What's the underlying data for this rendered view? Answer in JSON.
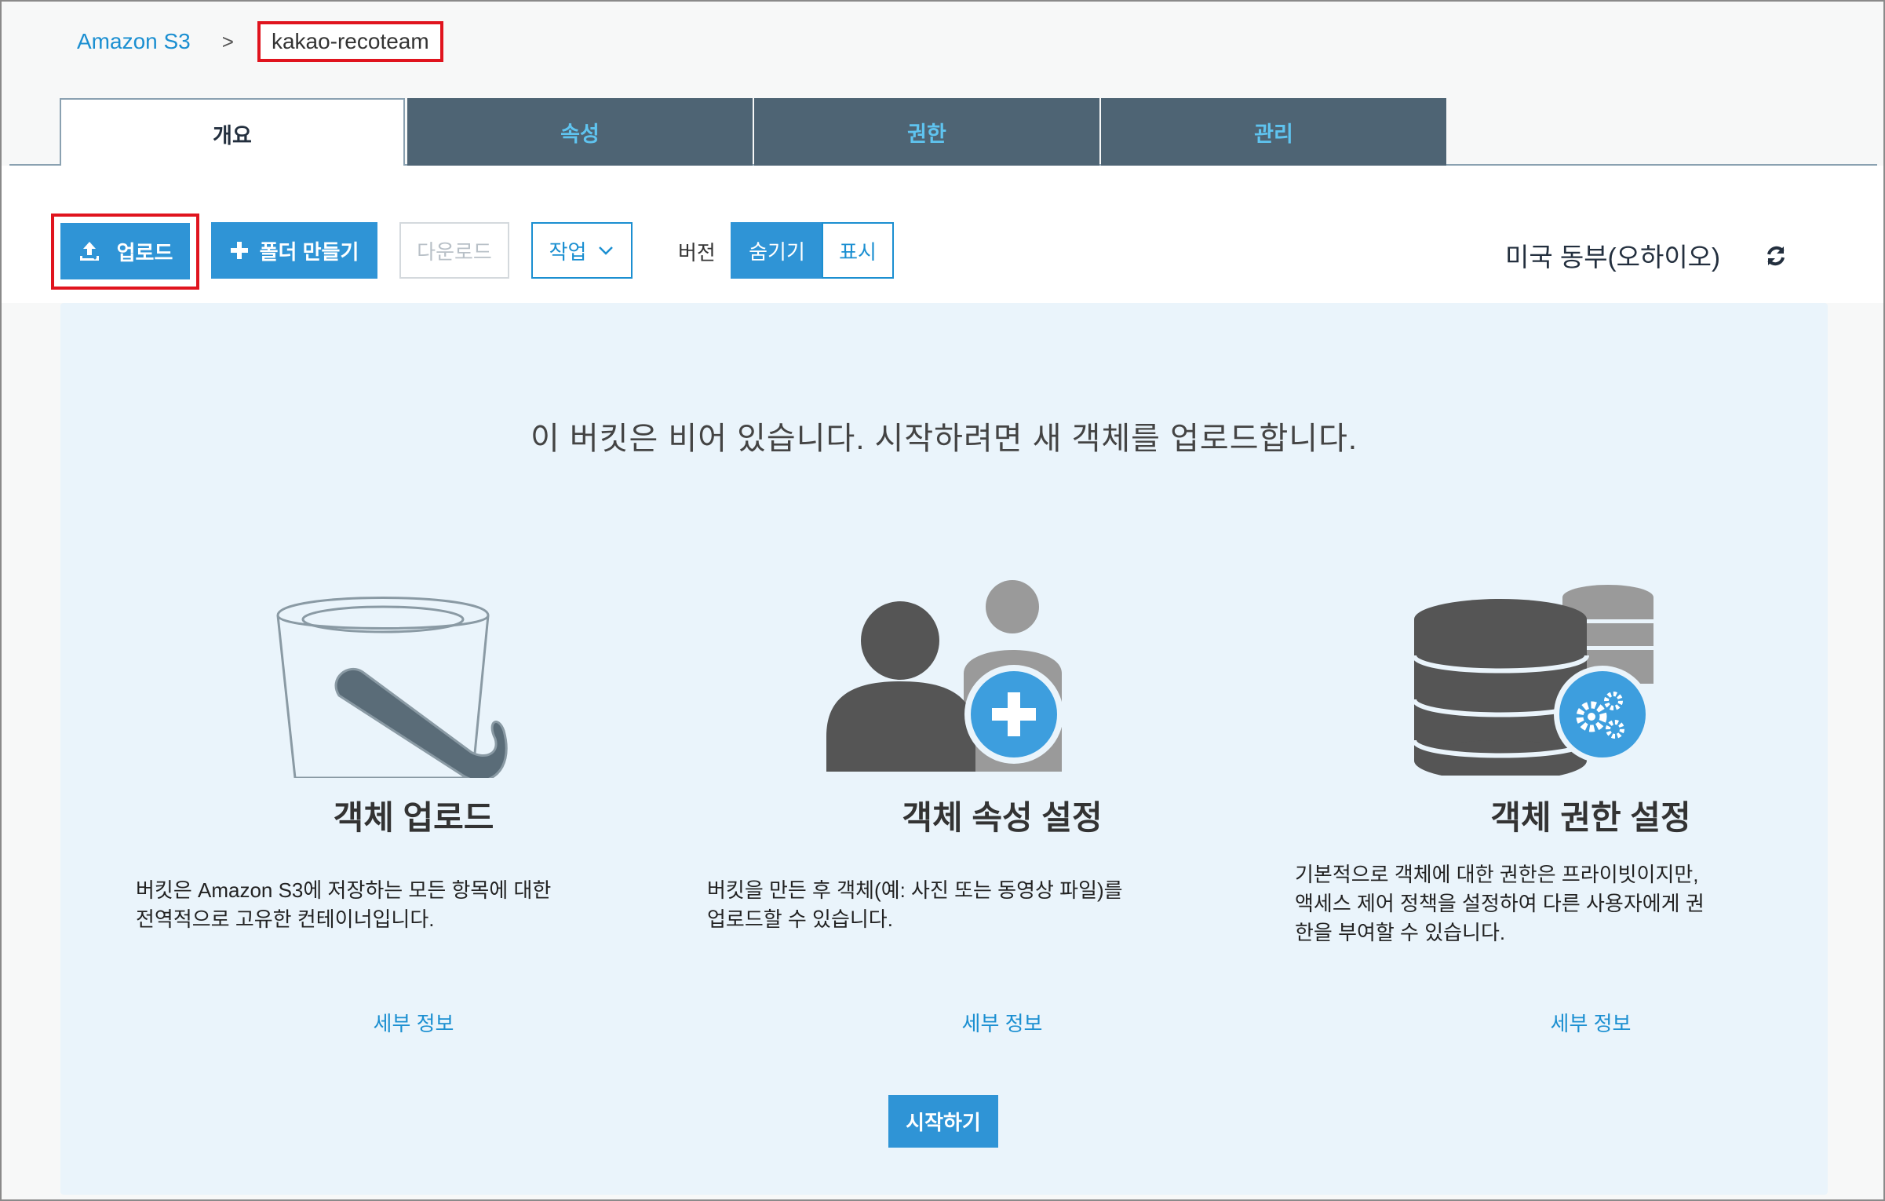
{
  "breadcrumb": {
    "root": "Amazon S3",
    "separator": ">",
    "current": "kakao-recoteam"
  },
  "tabs": [
    {
      "label": "개요",
      "active": true
    },
    {
      "label": "속성",
      "active": false
    },
    {
      "label": "권한",
      "active": false
    },
    {
      "label": "관리",
      "active": false
    }
  ],
  "toolbar": {
    "upload": "업로드",
    "create_folder": "폴더 만들기",
    "download": "다운로드",
    "actions": "작업",
    "version_label": "버전",
    "version_hide": "숨기기",
    "version_show": "표시",
    "region": "미국 동부(오하이오)"
  },
  "main": {
    "empty_message": "이 버킷은 비어 있습니다. 시작하려면 새 객체를 업로드합니다.",
    "columns": [
      {
        "title": "객체 업로드",
        "desc_line1": "버킷은 Amazon S3에 저장하는 모든 항목에 대한",
        "desc_line2": "전역적으로 고유한 컨테이너입니다.",
        "desc_line3": "",
        "link": "세부 정보",
        "icon": "bucket-icon"
      },
      {
        "title": "객체 속성 설정",
        "desc_line1": "버킷을 만든 후 객체(예: 사진 또는 동영상 파일)를",
        "desc_line2": "업로드할 수 있습니다.",
        "desc_line3": "",
        "link": "세부 정보",
        "icon": "add-users-icon"
      },
      {
        "title": "객체 권한 설정",
        "desc_line1": "기본적으로 객체에 대한 권한은 프라이빗이지만,",
        "desc_line2": "액세스 제어 정책을 설정하여 다른 사용자에게 권",
        "desc_line3": "한을 부여할 수 있습니다.",
        "link": "세부 정보",
        "icon": "database-settings-icon"
      }
    ],
    "start_button": "시작하기"
  },
  "colors": {
    "accent": "#2f94d6",
    "link": "#1b8fd1",
    "tab_inactive_bg": "#4e6474",
    "tab_inactive_text": "#5fc4f0",
    "highlight": "#e0141e",
    "panel_bg": "#eaf4fb"
  }
}
